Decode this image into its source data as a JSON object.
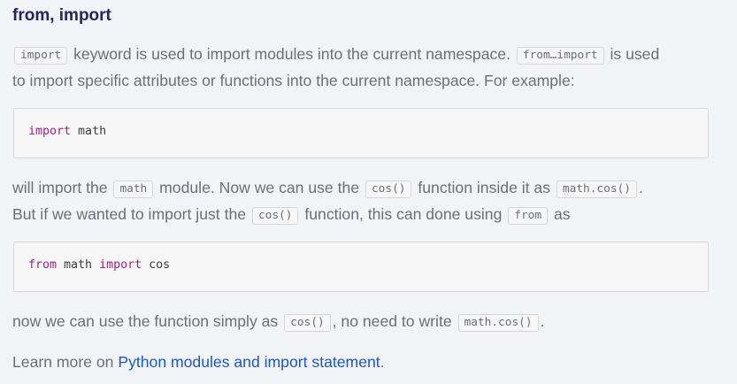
{
  "heading": "from, import",
  "para1": {
    "line1": {
      "code1": "import",
      "text1": " keyword is used to import modules into the current namespace. ",
      "code2": "from…import",
      "text2": " is used"
    },
    "line2": "to import specific attributes or functions into the current namespace. For example:"
  },
  "code_block1": {
    "keyword": "import",
    "rest": " math"
  },
  "para2": {
    "line1": {
      "text1": "will import the ",
      "code1": "math",
      "text2": " module. Now we can use the ",
      "code2": "cos()",
      "text3": " function inside it as ",
      "code3": "math.cos()",
      "text4": "."
    },
    "line2": {
      "text1": "But if we wanted to import just the ",
      "code1": "cos()",
      "text2": " function, this can done using ",
      "code2": "from",
      "text3": " as"
    }
  },
  "code_block2": {
    "keyword1": "from",
    "mid": " math ",
    "keyword2": "import",
    "rest": " cos"
  },
  "para3": {
    "text1": "now we can use the function simply as ",
    "code1": "cos()",
    "text2": ", no need to write ",
    "code2": "math.cos()",
    "text3": "."
  },
  "para4": {
    "text": "Learn more on ",
    "link": "Python modules and import statement",
    "end": "."
  },
  "colors": {
    "heading": "#25265e",
    "body_text": "#6b6f78",
    "keyword": "#a0227e",
    "link": "#1a57c9",
    "background": "#f1f3f6"
  }
}
